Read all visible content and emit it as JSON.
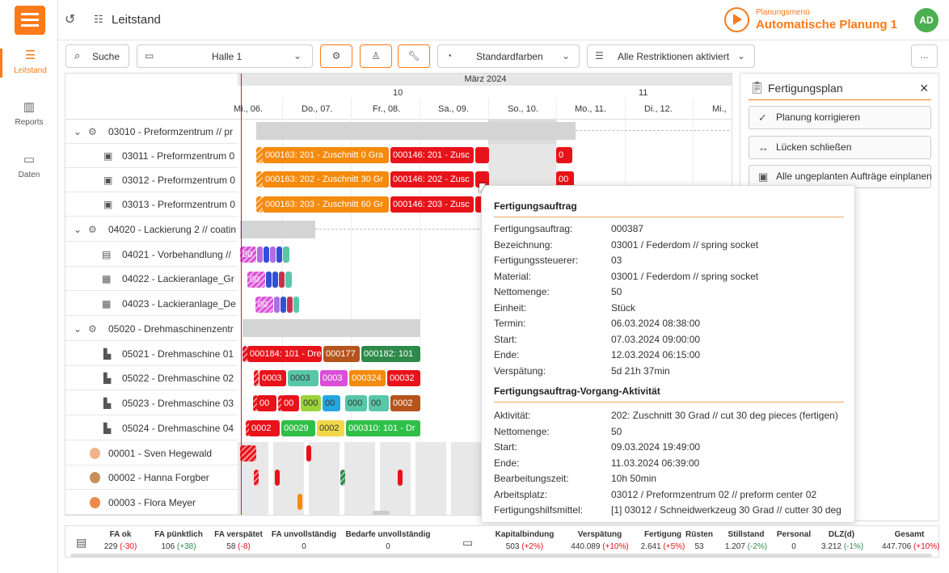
{
  "nav": {
    "items": [
      {
        "label": "Leitstand"
      },
      {
        "label": "Reports"
      },
      {
        "label": "Daten"
      }
    ]
  },
  "topbar": {
    "title": "Leitstand",
    "menu_sub": "Planungsmenü",
    "menu_main": "Automatische Planung 1",
    "avatar": "AD"
  },
  "toolbar": {
    "search": "Suche",
    "hall": "Halle 1",
    "colors": "Standardfarben",
    "restrictions": "Alle Restriktionen aktiviert",
    "more": "..."
  },
  "gantt": {
    "month": "März 2024",
    "weeks": [
      "10",
      "11"
    ],
    "days": [
      "Mi., 06.",
      "Do., 07.",
      "Fr., 08.",
      "Sa., 09.",
      "So., 10.",
      "Mo., 11.",
      "Di., 12.",
      "Mi.,"
    ],
    "rows": [
      {
        "label": "03010 - Preformzentrum // pr"
      },
      {
        "label": "03011 - Preformzentrum 0"
      },
      {
        "label": "03012 - Preformzentrum 0"
      },
      {
        "label": "03013 - Preformzentrum 0"
      },
      {
        "label": "04020 - Lackierung 2 // coatin"
      },
      {
        "label": "04021 - Vorbehandlung //"
      },
      {
        "label": "04022 - Lackieranlage_Gr"
      },
      {
        "label": "04023 - Lackieranlage_De"
      },
      {
        "label": "05020 - Drehmaschinenzentr"
      },
      {
        "label": "05021 - Drehmaschine 01"
      },
      {
        "label": "05022 - Drehmaschine 02"
      },
      {
        "label": "05023 - Drehmaschine 03"
      },
      {
        "label": "05024 - Drehmaschine 04"
      },
      {
        "label": "00001 - Sven Hegewald"
      },
      {
        "label": "00002 - Hanna Forgber"
      },
      {
        "label": "00003 - Flora Meyer"
      }
    ],
    "bars": {
      "r1": [
        "000163: 201 - Zuschnitt 0 Gra",
        "000146: 201 - Zusc",
        "0"
      ],
      "r2": [
        "000163: 202 - Zuschnitt 30 Gr",
        "000146: 202 - Zusc",
        "00"
      ],
      "r3": [
        "000163: 203 - Zuschnitt 60 Gr",
        "000146: 203 - Zusc"
      ],
      "r5": [
        "00"
      ],
      "r6": [
        "00"
      ],
      "r7": [
        "00"
      ],
      "r9": [
        "000184: 101 - Dre",
        "000177",
        "000182: 101"
      ],
      "r10": [
        "0003",
        "0003",
        "0003",
        "000324",
        "00032"
      ],
      "r11": [
        "00",
        "00",
        "000",
        "00",
        "000",
        "00",
        "0002"
      ],
      "r12": [
        "0002",
        "00029",
        "0002",
        "000310: 101 - Dr"
      ]
    }
  },
  "tooltip": {
    "sec1": "Fertigungsauftrag",
    "rows1": [
      {
        "k": "Fertigungsauftrag:",
        "v": "000387"
      },
      {
        "k": "Bezeichnung:",
        "v": "03001 / Federdom // spring socket"
      },
      {
        "k": "Fertigungssteuerer:",
        "v": "03"
      },
      {
        "k": "Material:",
        "v": "03001 / Federdom // spring socket"
      },
      {
        "k": "Nettomenge:",
        "v": "50"
      },
      {
        "k": "Einheit:",
        "v": "Stück"
      },
      {
        "k": "Termin:",
        "v": "06.03.2024 08:38:00"
      },
      {
        "k": "Start:",
        "v": "07.03.2024 09:00:00"
      },
      {
        "k": "Ende:",
        "v": "12.03.2024 06:15:00"
      },
      {
        "k": "Verspätung:",
        "v": "5d 21h 37min"
      }
    ],
    "sec2": "Fertigungsauftrag-Vorgang-Aktivität",
    "rows2": [
      {
        "k": "Aktivität:",
        "v": "202: Zuschnitt 30 Grad // cut 30 deg pieces (fertigen)"
      },
      {
        "k": "Nettomenge:",
        "v": "50"
      },
      {
        "k": "Start:",
        "v": "09.03.2024 19:49:00"
      },
      {
        "k": "Ende:",
        "v": "11.03.2024 06:39:00"
      },
      {
        "k": "Bearbeitungszeit:",
        "v": "10h 50min"
      },
      {
        "k": "Arbeitsplatz:",
        "v": "03012 / Preformzentrum 02 // preform center 02"
      },
      {
        "k": "Fertigungshilfsmittel:",
        "v": "[1] 03012 / Schneidwerkzeug 30 Grad // cutter 30 deg"
      }
    ]
  },
  "panel": {
    "title": "Fertigungsplan",
    "close": "×",
    "buttons": [
      "Planung korrigieren",
      "Lücken schließen",
      "Alle ungeplanten Aufträge einplanen"
    ]
  },
  "kpis": {
    "left": [
      {
        "t": "FA ok",
        "v": "229",
        "d": "(-30)"
      },
      {
        "t": "FA pünktlich",
        "v": "106",
        "d": "(+38)"
      },
      {
        "t": "FA verspätet",
        "v": "58",
        "d": "(-8)"
      },
      {
        "t": "FA unvollständig",
        "v": "0",
        "d": ""
      },
      {
        "t": "Bedarfe unvollständig",
        "v": "0",
        "d": ""
      }
    ],
    "right": [
      {
        "t": "Kapitalbindung",
        "v": "503",
        "d": "(+2%)"
      },
      {
        "t": "Verspätung",
        "v": "440.089",
        "d": "(+10%)"
      },
      {
        "t": "Fertigung",
        "v": "2.641",
        "d": "(+5%)"
      },
      {
        "t": "Rüsten",
        "v": "53",
        "d": ""
      },
      {
        "t": "Stillstand",
        "v": "1.207",
        "d": "(-2%)"
      },
      {
        "t": "Personal",
        "v": "0",
        "d": ""
      },
      {
        "t": "DLZ(d)",
        "v": "3.212",
        "d": "(-1%)"
      },
      {
        "t": "Gesamt",
        "v": "447.706",
        "d": "(+10%)"
      }
    ]
  },
  "colors": {
    "accent": "#ff7a1a",
    "late": "#e8121a",
    "ok": "#2d8a4a"
  }
}
